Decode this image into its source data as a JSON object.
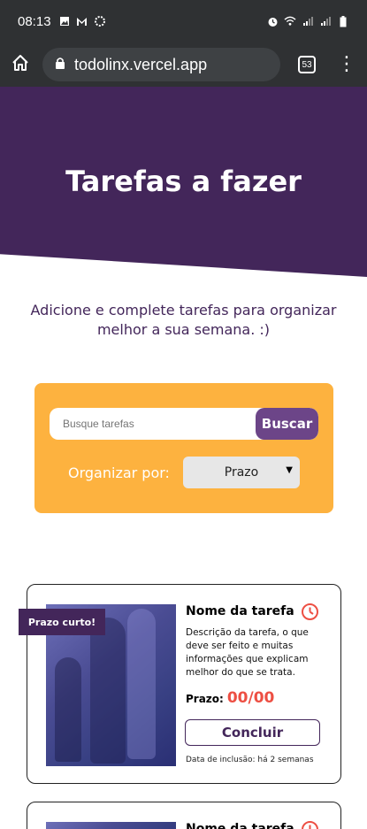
{
  "status_bar": {
    "time": "08:13",
    "left_icons": [
      "image-icon",
      "gmail-icon",
      "loading-icon"
    ],
    "right_icons": [
      "alarm-icon",
      "wifi-icon",
      "signal-icon",
      "signal-icon",
      "battery-icon"
    ]
  },
  "browser": {
    "url": "todolinx.vercel.app",
    "tab_count": "53"
  },
  "hero": {
    "title": "Tarefas a fazer"
  },
  "intro": "Adicione e complete tarefas para organizar melhor a sua semana. :)",
  "search": {
    "placeholder": "Busque tarefas",
    "button_label": "Buscar"
  },
  "sort": {
    "label": "Organizar por:",
    "selected": "Prazo"
  },
  "tasks": [
    {
      "badge": "Prazo curto!",
      "title": "Nome da tarefa",
      "description": "Descrição da tarefa, o que deve ser feito e muitas informações que explicam melhor do que se trata.",
      "deadline_label": "Prazo:",
      "deadline_value": "00/00",
      "complete_label": "Concluir",
      "added": "Data de inclusão: há 2 semanas"
    },
    {
      "title": "Nome da tarefa"
    }
  ],
  "colors": {
    "purple": "#43265a",
    "accent_purple": "#6c4588",
    "orange": "#fdb23f",
    "red": "#ed4f43"
  }
}
